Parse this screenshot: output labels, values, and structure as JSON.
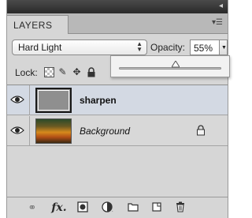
{
  "panel": {
    "tab_label": "LAYERS",
    "menu_icon": "panel-menu-icon"
  },
  "blend": {
    "mode": "Hard Light",
    "opacity_label": "Opacity:",
    "opacity_value": "55%",
    "opacity_percent": 55
  },
  "lock": {
    "label": "Lock:",
    "icons": [
      "lock-transparent-icon",
      "lock-image-icon",
      "lock-position-icon",
      "lock-all-icon"
    ]
  },
  "layers": [
    {
      "name": "sharpen",
      "selected": true,
      "visible": true,
      "locked": false
    },
    {
      "name": "Background",
      "selected": false,
      "visible": true,
      "locked": true
    }
  ],
  "toolbar": {
    "icons": [
      "link-layers-icon",
      "fx-icon",
      "add-mask-icon",
      "adjustment-layer-icon",
      "new-group-icon",
      "new-layer-icon",
      "trash-icon"
    ]
  },
  "colors": {
    "selected_row": "#d3d9e3",
    "panel_bg": "#d6d6d6"
  }
}
